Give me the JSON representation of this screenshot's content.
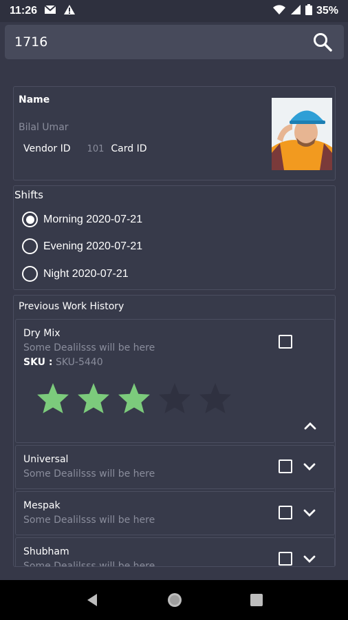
{
  "status_bar": {
    "time": "11:26",
    "battery": "35%"
  },
  "search": {
    "value": "1716"
  },
  "profile": {
    "name_label": "Name",
    "name_value": "Bilal Umar",
    "vendor_id_label": "Vendor ID",
    "vendor_id_value": "101",
    "card_id_label": "Card ID"
  },
  "shifts": {
    "title": "Shifts",
    "options": [
      {
        "label": "Morning 2020-07-21",
        "selected": true
      },
      {
        "label": "Evening 2020-07-21",
        "selected": false
      },
      {
        "label": "Night 2020-07-21",
        "selected": false
      }
    ]
  },
  "history": {
    "title": "Previous Work History",
    "items": [
      {
        "title": "Dry Mix",
        "desc": "Some Dealilsss will be here",
        "sku_label": "SKU :",
        "sku_value": "SKU-5440",
        "rating": 3,
        "rating_max": 5,
        "expanded": true
      },
      {
        "title": "Universal",
        "desc": "Some Dealilsss will be here",
        "expanded": false
      },
      {
        "title": "Mespak",
        "desc": "Some Dealilsss will be here",
        "expanded": false
      },
      {
        "title": "Shubham",
        "desc": "Some Dealilsss will be here",
        "expanded": false
      }
    ]
  },
  "colors": {
    "star_filled": "#7ccb7c",
    "star_empty": "#2f3140",
    "background": "#363848"
  }
}
